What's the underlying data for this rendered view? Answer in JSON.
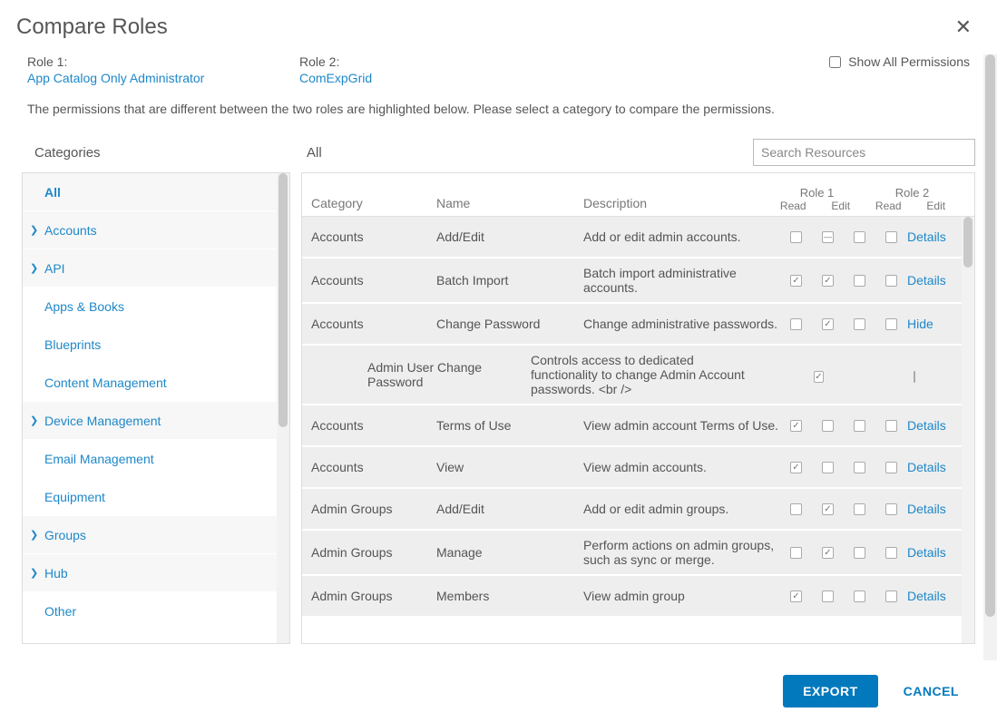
{
  "modal": {
    "title": "Compare Roles",
    "close_aria": "Close"
  },
  "role1": {
    "label": "Role 1:",
    "name": "App Catalog Only Administrator"
  },
  "role2": {
    "label": "Role 2:",
    "name": "ComExpGrid"
  },
  "show_all_permissions_label": "Show All Permissions",
  "description": "The permissions that are different between the two roles are highlighted below. Please select a category to compare the permissions.",
  "categories_label": "Categories",
  "all_label": "All",
  "search_placeholder": "Search Resources",
  "categories": [
    {
      "label": "All",
      "expandable": false,
      "all": true
    },
    {
      "label": "Accounts",
      "expandable": true
    },
    {
      "label": "API",
      "expandable": true
    },
    {
      "label": "Apps & Books",
      "expandable": false,
      "light": true
    },
    {
      "label": "Blueprints",
      "expandable": false,
      "light": true
    },
    {
      "label": "Content Management",
      "expandable": false,
      "light": true
    },
    {
      "label": "Device Management",
      "expandable": true
    },
    {
      "label": "Email Management",
      "expandable": false,
      "light": true
    },
    {
      "label": "Equipment",
      "expandable": false,
      "light": true
    },
    {
      "label": "Groups",
      "expandable": true
    },
    {
      "label": "Hub",
      "expandable": true
    },
    {
      "label": "Other",
      "expandable": false,
      "light": true
    }
  ],
  "table": {
    "headers": {
      "category": "Category",
      "name": "Name",
      "description": "Description",
      "role1": "Role 1",
      "role2": "Role 2",
      "read": "Read",
      "edit": "Edit"
    },
    "rows": [
      {
        "category": "Accounts",
        "name": "Add/Edit",
        "description": "Add or edit admin accounts.",
        "r1_read": "",
        "r1_edit": "indet",
        "r2_read": "",
        "r2_edit": "",
        "link": "Details"
      },
      {
        "category": "Accounts",
        "name": "Batch Import",
        "description": "Batch import administrative accounts.",
        "r1_read": "checked",
        "r1_edit": "checked",
        "r2_read": "",
        "r2_edit": "",
        "link": "Details"
      },
      {
        "category": "Accounts",
        "name": "Change Password",
        "description": "Change administrative passwords.",
        "r1_read": "",
        "r1_edit": "checked",
        "r2_read": "",
        "r2_edit": "",
        "link": "Hide"
      },
      {
        "sub": true,
        "name": "Admin User Change Password",
        "description": "Controls access to dedicated functionality to change Admin Account passwords. <br />",
        "s1": "checked",
        "s2": ""
      },
      {
        "category": "Accounts",
        "name": "Terms of Use",
        "description": "View admin account Terms of Use.",
        "r1_read": "checked",
        "r1_edit": "",
        "r2_read": "",
        "r2_edit": "",
        "link": "Details"
      },
      {
        "category": "Accounts",
        "name": "View",
        "description": "View admin accounts.",
        "r1_read": "checked",
        "r1_edit": "",
        "r2_read": "",
        "r2_edit": "",
        "link": "Details"
      },
      {
        "category": "Admin Groups",
        "name": "Add/Edit",
        "description": "Add or edit admin groups.",
        "r1_read": "",
        "r1_edit": "checked",
        "r2_read": "",
        "r2_edit": "",
        "link": "Details"
      },
      {
        "category": "Admin Groups",
        "name": "Manage",
        "description": "Perform actions on admin groups, such as sync or merge.",
        "r1_read": "",
        "r1_edit": "checked",
        "r2_read": "",
        "r2_edit": "",
        "link": "Details"
      },
      {
        "category": "Admin Groups",
        "name": "Members",
        "description": "View admin group",
        "r1_read": "checked",
        "r1_edit": "",
        "r2_read": "",
        "r2_edit": "",
        "link": "Details"
      }
    ]
  },
  "footer": {
    "export": "EXPORT",
    "cancel": "CANCEL"
  }
}
